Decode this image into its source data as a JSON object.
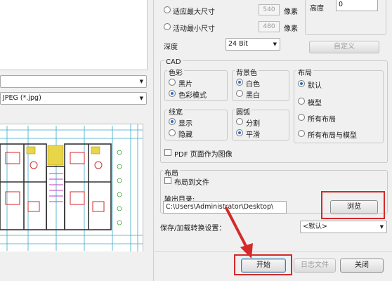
{
  "left": {
    "format_value": "JPEG (*.jpg)"
  },
  "size": {
    "fit_label": "适应最大尺寸",
    "fit_width": "540",
    "fit_unit": "像素",
    "window_label": "活动最小尺寸",
    "window_height": "480",
    "window_unit": "像素",
    "depth_label": "深度",
    "depth_value": "24 Bit",
    "height_label": "高度",
    "height_value": "0",
    "custom_button": "自定义"
  },
  "cad": {
    "title": "CAD",
    "color": {
      "title": "色彩",
      "opt1": "黑片",
      "opt2": "色彩模式"
    },
    "background": {
      "title": "背景色",
      "opt1": "白色",
      "opt2": "黑白"
    },
    "layout": {
      "title": "布局",
      "opt1": "默认",
      "opt2": "模型",
      "opt3": "所有布局",
      "opt4": "所有布局与模型"
    },
    "lineweight": {
      "title": "线宽",
      "opt1": "显示",
      "opt2": "隐藏"
    },
    "arc": {
      "title": "圆弧",
      "opt1": "分割",
      "opt2": "平滑"
    },
    "pdf_checkbox": "PDF 页面作为图像"
  },
  "layout_section": {
    "title": "布局",
    "to_file_checkbox": "布局到文件"
  },
  "output": {
    "label": "输出目录:",
    "path": "C:\\Users\\Administrator\\Desktop\\",
    "browse_button": "浏览"
  },
  "settings": {
    "label": "保存/加载转换设置：",
    "value": "<默认>"
  },
  "footer": {
    "start_button": "开始",
    "save_list_button": "日志文件",
    "close_button": "关闭"
  },
  "colors": {
    "highlight_box": "#d42a2a",
    "radio_dot": "#2a6fc9"
  }
}
